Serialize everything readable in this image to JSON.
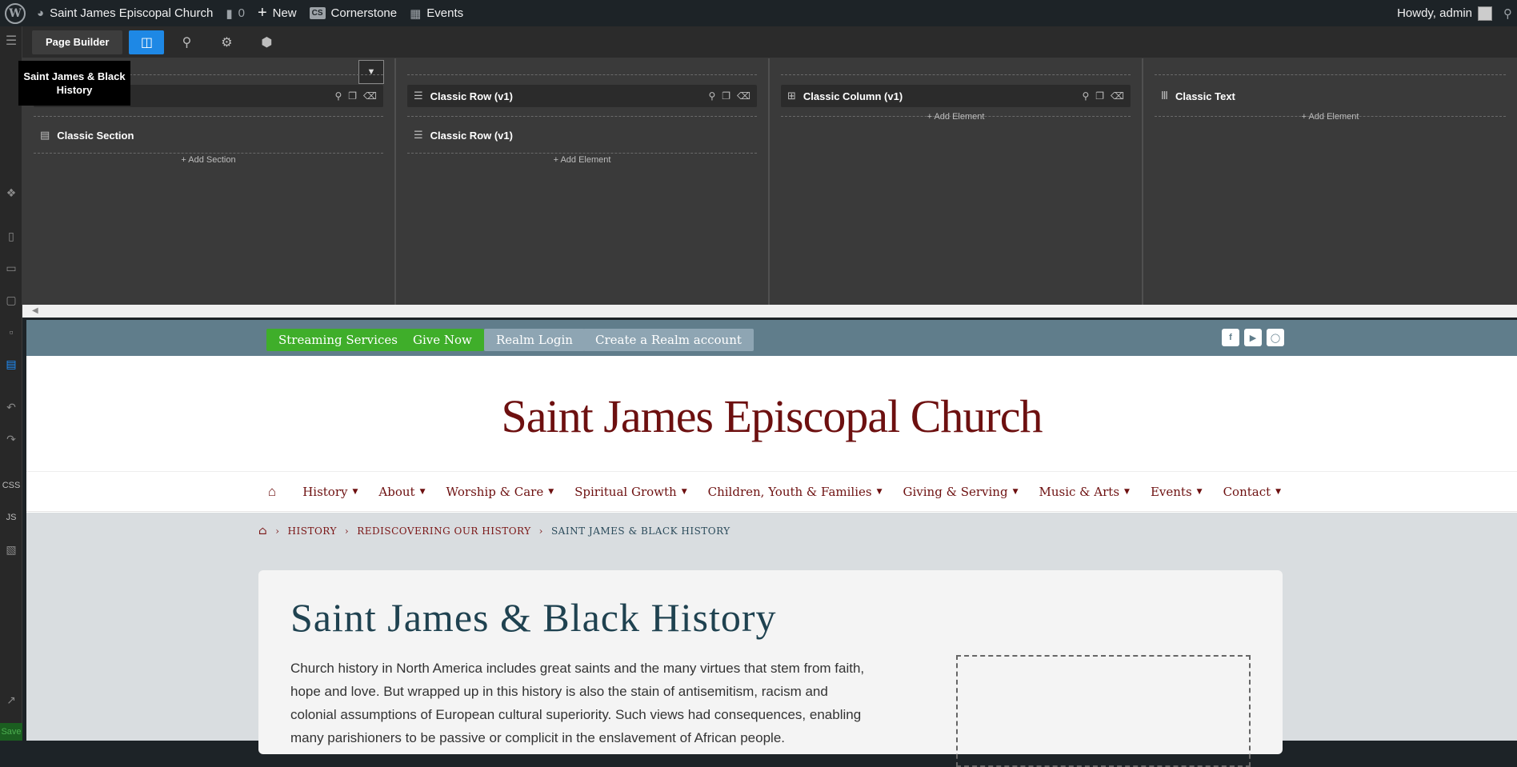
{
  "adminbar": {
    "site_name": "Saint James Episcopal Church",
    "comments_count": "0",
    "new_label": "New",
    "cornerstone_label": "Cornerstone",
    "events_label": "Events",
    "howdy": "Howdy, admin"
  },
  "toolbar": {
    "page_builder_label": "Page Builder"
  },
  "tooltip": {
    "text": "Saint James & Black History"
  },
  "builder": {
    "columns": [
      {
        "header": "",
        "sub_item": "Classic Section",
        "add_label": "Add Section"
      },
      {
        "header": "Classic Row (v1)",
        "sub_item": "Classic Row (v1)",
        "add_label": "Add Element"
      },
      {
        "header": "Classic Column (v1)",
        "add_label": "Add Element"
      },
      {
        "header": "Classic Text",
        "add_label": "Add Element"
      }
    ]
  },
  "leftbar": {
    "css_label": "CSS",
    "js_label": "JS",
    "save_label": "Save"
  },
  "site": {
    "top_buttons": [
      {
        "label": "Streaming Services",
        "color": "#3fae2a"
      },
      {
        "label": "Give Now",
        "color": "#3fae2a"
      },
      {
        "label": "Realm Login",
        "color": "#8ea5b3"
      },
      {
        "label": "Create a Realm account",
        "color": "#8ea5b3"
      }
    ],
    "title": "Saint James Episcopal Church",
    "nav": [
      "History",
      "About",
      "Worship & Care",
      "Spiritual Growth",
      "Children, Youth & Families",
      "Giving & Serving",
      "Music & Arts",
      "Events",
      "Contact"
    ],
    "breadcrumbs": [
      "HISTORY",
      "REDISCOVERING OUR HISTORY",
      "SAINT JAMES & BLACK HISTORY"
    ],
    "page_title": "Saint James & Black History",
    "body_text": "Church history in North America includes great saints and the many virtues that stem from faith, hope and love. But wrapped up in this history is also the stain of antisemitism, racism and colonial assumptions of European cultural superiority. Such views had consequences, enabling many parishioners to be passive or complicit in the enslavement of African people."
  },
  "colors": {
    "brand": "#6d1010",
    "topbar": "#607d8b",
    "heading": "#1f4250",
    "builder_accent": "#1e88e5"
  }
}
